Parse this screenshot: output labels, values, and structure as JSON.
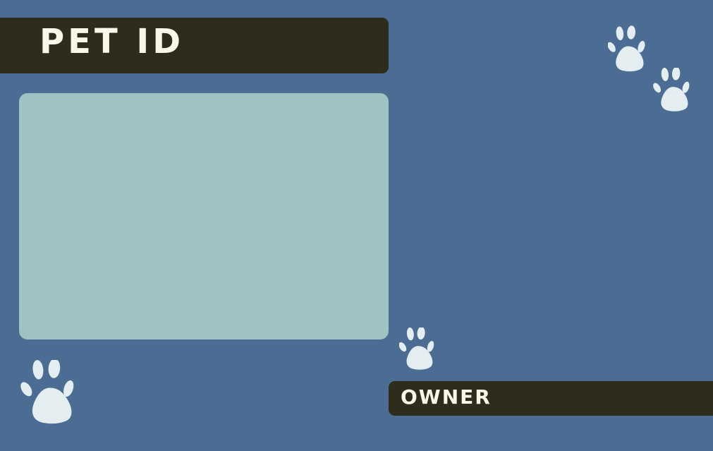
{
  "header": {
    "title": "PET ID"
  },
  "owner_section": {
    "label": "OWNER"
  },
  "icons": {
    "paw": "paw-print-icon"
  },
  "colors": {
    "background": "#4b6d94",
    "bar": "#2f2c1b",
    "photo_area": "#9fc2c3",
    "paw": "#e4eef1",
    "text": "#fbf6ea"
  }
}
